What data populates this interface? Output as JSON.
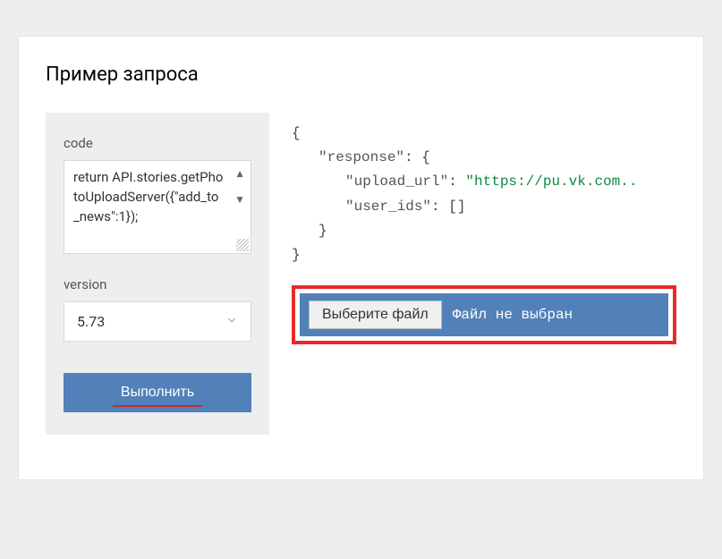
{
  "title": "Пример запроса",
  "form": {
    "codeLabel": "code",
    "codeValue": "return API.stories.getPhotoUploadServer({\"add_to_news\":1});",
    "versionLabel": "version",
    "versionValue": "5.73",
    "executeLabel": "Выполнить"
  },
  "response": {
    "open": "{",
    "respKey": "\"response\"",
    "respOpen": ": {",
    "urlKey": "\"upload_url\"",
    "urlSep": ": ",
    "urlVal": "\"https://pu.vk.com..",
    "idsKey": "\"user_ids\"",
    "idsVal": ": []",
    "closeInner": "}",
    "closeOuter": "}"
  },
  "filePicker": {
    "chooseLabel": "Выберите файл",
    "statusLabel": "Файл не выбран"
  }
}
